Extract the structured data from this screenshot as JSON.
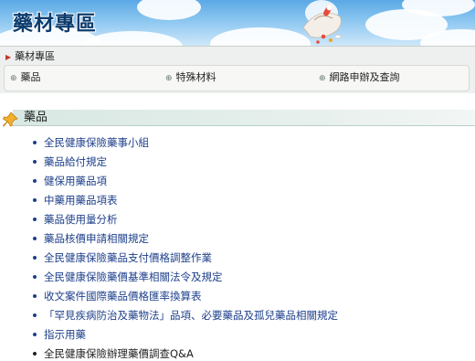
{
  "banner": {
    "title": "藥材專區"
  },
  "breadcrumb": {
    "label": "藥材專區"
  },
  "nav": {
    "items": [
      {
        "label": "藥品"
      },
      {
        "label": "特殊材料"
      },
      {
        "label": "網路申辦及查詢"
      }
    ]
  },
  "section": {
    "title": "藥品"
  },
  "links": [
    {
      "label": "全民健康保險藥事小組"
    },
    {
      "label": "藥品給付規定"
    },
    {
      "label": "健保用藥品項"
    },
    {
      "label": "中藥用藥品項表"
    },
    {
      "label": "藥品使用量分析"
    },
    {
      "label": "藥品核價申請相關規定"
    },
    {
      "label": "全民健康保險藥品支付價格調整作業"
    },
    {
      "label": "全民健康保險藥價基準相關法令及規定"
    },
    {
      "label": "收文案件國際藥品價格匯率換算表"
    },
    {
      "label": "「罕見疾病防治及藥物法」品項、必要藥品及孤兒藥品相關規定"
    },
    {
      "label": "指示用藥"
    },
    {
      "label": "全民健康保險辦理藥價調查Q&A"
    }
  ],
  "colors": {
    "link": "#1d3f8a",
    "banner_title": "#0c3c6e",
    "section_bar": "#d8e8e2"
  }
}
